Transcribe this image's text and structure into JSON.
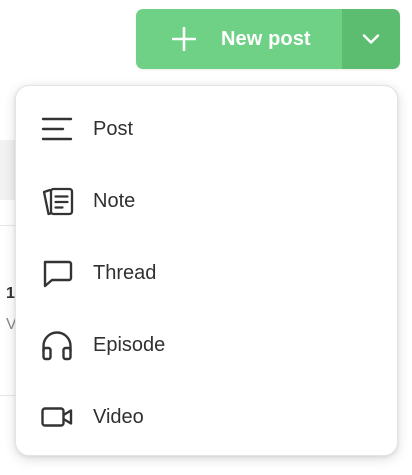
{
  "background": {
    "char_1": "1",
    "char_2": "V"
  },
  "split_button": {
    "label": "New post",
    "plus_icon": "plus-icon",
    "toggle_icon": "chevron-down-icon",
    "primary_color": "#6fd186",
    "toggle_color": "#5cbd71"
  },
  "menu": {
    "items": [
      {
        "label": "Post",
        "icon": "lines-icon"
      },
      {
        "label": "Note",
        "icon": "notes-icon"
      },
      {
        "label": "Thread",
        "icon": "chat-bubble-icon"
      },
      {
        "label": "Episode",
        "icon": "headphones-icon"
      },
      {
        "label": "Video",
        "icon": "video-camera-icon"
      }
    ]
  }
}
